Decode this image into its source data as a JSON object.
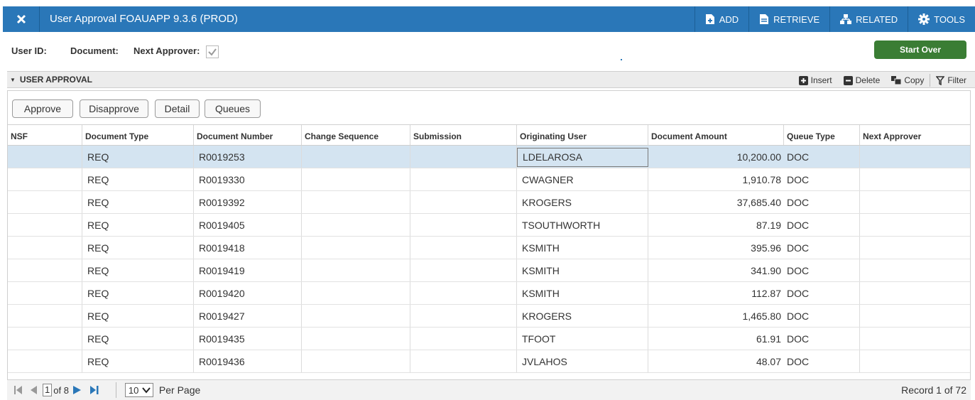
{
  "window": {
    "title": "User Approval FOAUAPP 9.3.6 (PROD)",
    "close_icon": "close-icon",
    "actions": [
      {
        "label": "ADD",
        "icon": "add-document-icon"
      },
      {
        "label": "RETRIEVE",
        "icon": "retrieve-document-icon"
      },
      {
        "label": "RELATED",
        "icon": "related-icon"
      },
      {
        "label": "TOOLS",
        "icon": "gear-icon"
      }
    ]
  },
  "key_block": {
    "user_id_label": "User ID:",
    "document_label": "Document:",
    "next_approver_label": "Next Approver:",
    "next_approver_checked": true,
    "start_over_label": "Start Over"
  },
  "section": {
    "title": "USER APPROVAL",
    "tools": [
      {
        "label": "Insert",
        "icon": "plus-icon"
      },
      {
        "label": "Delete",
        "icon": "minus-icon"
      },
      {
        "label": "Copy",
        "icon": "copy-icon"
      },
      {
        "label": "Filter",
        "icon": "filter-icon"
      }
    ]
  },
  "buttons": [
    "Approve",
    "Disapprove",
    "Detail",
    "Queues"
  ],
  "grid": {
    "columns": [
      "NSF",
      "Document Type",
      "Document Number",
      "Change Sequence",
      "Submission",
      "Originating User",
      "Document Amount",
      "Queue Type",
      "Next Approver"
    ],
    "rows": [
      {
        "nsf": "",
        "doc_type": "REQ",
        "doc_number": "R0019253",
        "change_seq": "",
        "submission": "",
        "orig_user": "LDELAROSA",
        "amount": "10,200.00",
        "queue_type": "DOC",
        "next_approver": ""
      },
      {
        "nsf": "",
        "doc_type": "REQ",
        "doc_number": "R0019330",
        "change_seq": "",
        "submission": "",
        "orig_user": "CWAGNER",
        "amount": "1,910.78",
        "queue_type": "DOC",
        "next_approver": ""
      },
      {
        "nsf": "",
        "doc_type": "REQ",
        "doc_number": "R0019392",
        "change_seq": "",
        "submission": "",
        "orig_user": "KROGERS",
        "amount": "37,685.40",
        "queue_type": "DOC",
        "next_approver": ""
      },
      {
        "nsf": "",
        "doc_type": "REQ",
        "doc_number": "R0019405",
        "change_seq": "",
        "submission": "",
        "orig_user": "TSOUTHWORTH",
        "amount": "87.19",
        "queue_type": "DOC",
        "next_approver": ""
      },
      {
        "nsf": "",
        "doc_type": "REQ",
        "doc_number": "R0019418",
        "change_seq": "",
        "submission": "",
        "orig_user": "KSMITH",
        "amount": "395.96",
        "queue_type": "DOC",
        "next_approver": ""
      },
      {
        "nsf": "",
        "doc_type": "REQ",
        "doc_number": "R0019419",
        "change_seq": "",
        "submission": "",
        "orig_user": "KSMITH",
        "amount": "341.90",
        "queue_type": "DOC",
        "next_approver": ""
      },
      {
        "nsf": "",
        "doc_type": "REQ",
        "doc_number": "R0019420",
        "change_seq": "",
        "submission": "",
        "orig_user": "KSMITH",
        "amount": "112.87",
        "queue_type": "DOC",
        "next_approver": ""
      },
      {
        "nsf": "",
        "doc_type": "REQ",
        "doc_number": "R0019427",
        "change_seq": "",
        "submission": "",
        "orig_user": "KROGERS",
        "amount": "1,465.80",
        "queue_type": "DOC",
        "next_approver": ""
      },
      {
        "nsf": "",
        "doc_type": "REQ",
        "doc_number": "R0019435",
        "change_seq": "",
        "submission": "",
        "orig_user": "TFOOT",
        "amount": "61.91",
        "queue_type": "DOC",
        "next_approver": ""
      },
      {
        "nsf": "",
        "doc_type": "REQ",
        "doc_number": "R0019436",
        "change_seq": "",
        "submission": "",
        "orig_user": "JVLAHOS",
        "amount": "48.07",
        "queue_type": "DOC",
        "next_approver": ""
      }
    ]
  },
  "pager": {
    "current_page": "1",
    "of_pages": "of 8",
    "per_page_value": "10",
    "per_page_label": "Per Page",
    "record_text": "Record 1 of 72"
  },
  "colors": {
    "header_blue": "#2a77b8",
    "start_over_green": "#3a7d34",
    "selected_row": "#d4e4f1"
  }
}
